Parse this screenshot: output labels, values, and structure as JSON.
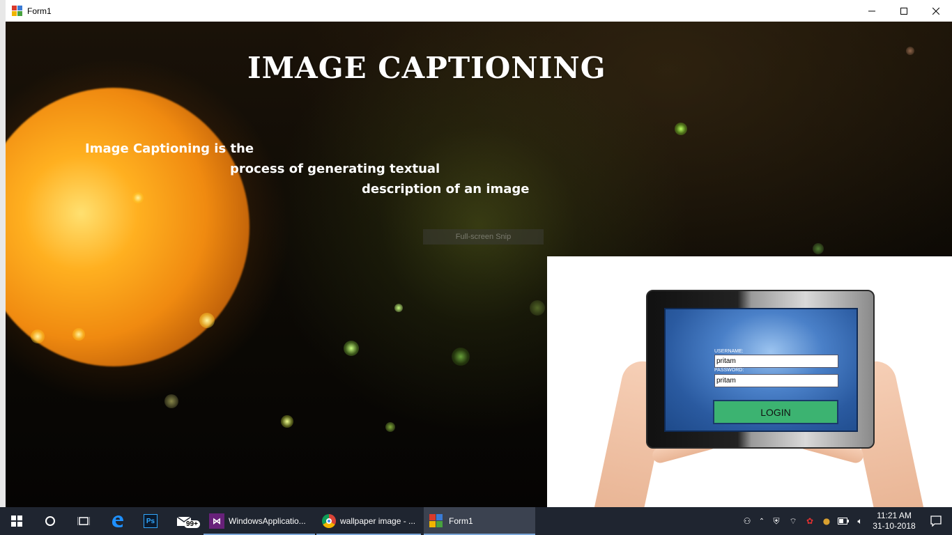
{
  "window": {
    "title": "Form1",
    "controls": {
      "minimize_icon": "minimize-icon",
      "maximize_icon": "maximize-icon",
      "close_icon": "close-icon"
    }
  },
  "content": {
    "heading": "IMAGE CAPTIONING",
    "caption_lines": [
      "Image Captioning is the",
      "process of generating textual",
      "description of an image"
    ],
    "overlay_label": "Full-screen Snip"
  },
  "login": {
    "username_label": "USERNAME:",
    "username_value": "pritam",
    "password_label": "PASSWORD:",
    "password_value": "pritam",
    "login_button": "LOGIN",
    "button_color": "#3cb371"
  },
  "taskbar": {
    "tasks": [
      {
        "label": "WindowsApplicatio...",
        "icon": "visual-studio-icon"
      },
      {
        "label": "wallpaper image - ...",
        "icon": "chrome-icon"
      },
      {
        "label": "Form1",
        "icon": "form-app-icon"
      }
    ],
    "badge": "99+",
    "clock_time": "11:21 AM",
    "clock_date": "31-10-2018"
  }
}
